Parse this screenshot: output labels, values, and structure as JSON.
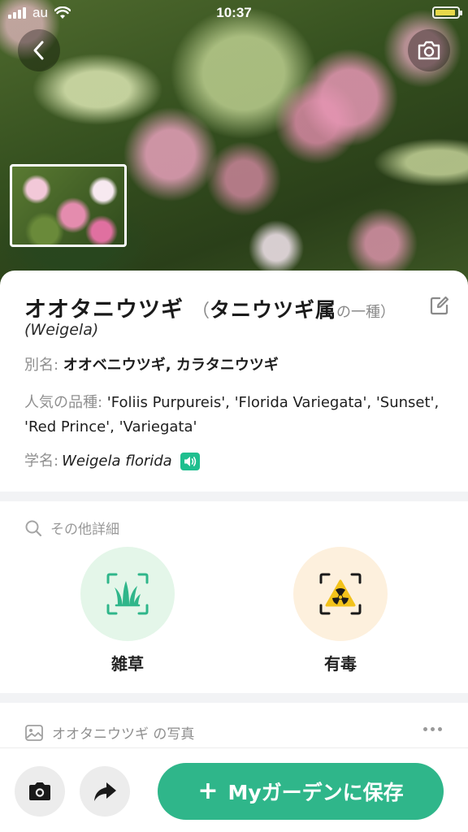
{
  "status_bar": {
    "carrier": "au",
    "time": "10:37"
  },
  "header": {
    "back_icon": "chevron-left-icon",
    "camera_icon": "camera-icon"
  },
  "plant": {
    "common_name": "オオタニウツギ",
    "genus_open": "（",
    "genus_name": "タニウツギ属",
    "genus_suffix": "の一種）",
    "latin_genus": "(Weigela)",
    "alias_label": "別名: ",
    "alias_value": "オオベニウツギ, カラタニウツギ",
    "varieties_label": "人気の品種: ",
    "varieties_value": "'Foliis Purpureis', 'Florida Variegata', 'Sunset', 'Red Prince', 'Variegata'",
    "scientific_label": "学名: ",
    "scientific_value": "Weigela florida"
  },
  "details": {
    "header": "その他詳細",
    "features": [
      {
        "label": "雑草",
        "icon": "grass-icon",
        "color": "#2fb68a"
      },
      {
        "label": "有毒",
        "icon": "toxic-icon",
        "color": "#f2c21b"
      }
    ]
  },
  "photos": {
    "header": "オオタニウツギ の写真"
  },
  "bottom_bar": {
    "save_label": "Myガーデンに保存",
    "save_plus": "+"
  },
  "colors": {
    "accent": "#2fb68a",
    "weed_bg": "#e4f6e9",
    "toxic_bg": "#fdf0dd"
  }
}
